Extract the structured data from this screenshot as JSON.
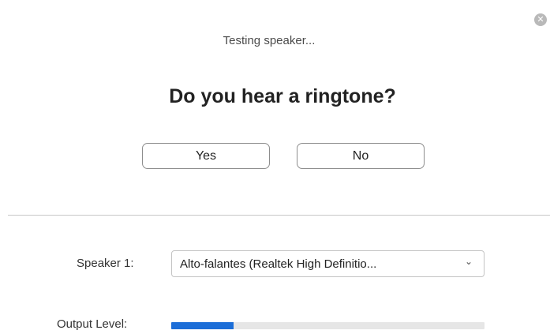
{
  "dialog": {
    "close_icon": "close-icon",
    "status_text": "Testing speaker...",
    "question": "Do you hear a ringtone?",
    "yes_label": "Yes",
    "no_label": "No"
  },
  "speaker": {
    "label": "Speaker 1:",
    "selected_device": "Alto-falantes (Realtek High Definitio...",
    "dropdown_icon": "chevron-down-icon"
  },
  "output_level": {
    "label": "Output Level:",
    "level_fraction": 0.2,
    "fill_color": "#1c6ed8"
  }
}
